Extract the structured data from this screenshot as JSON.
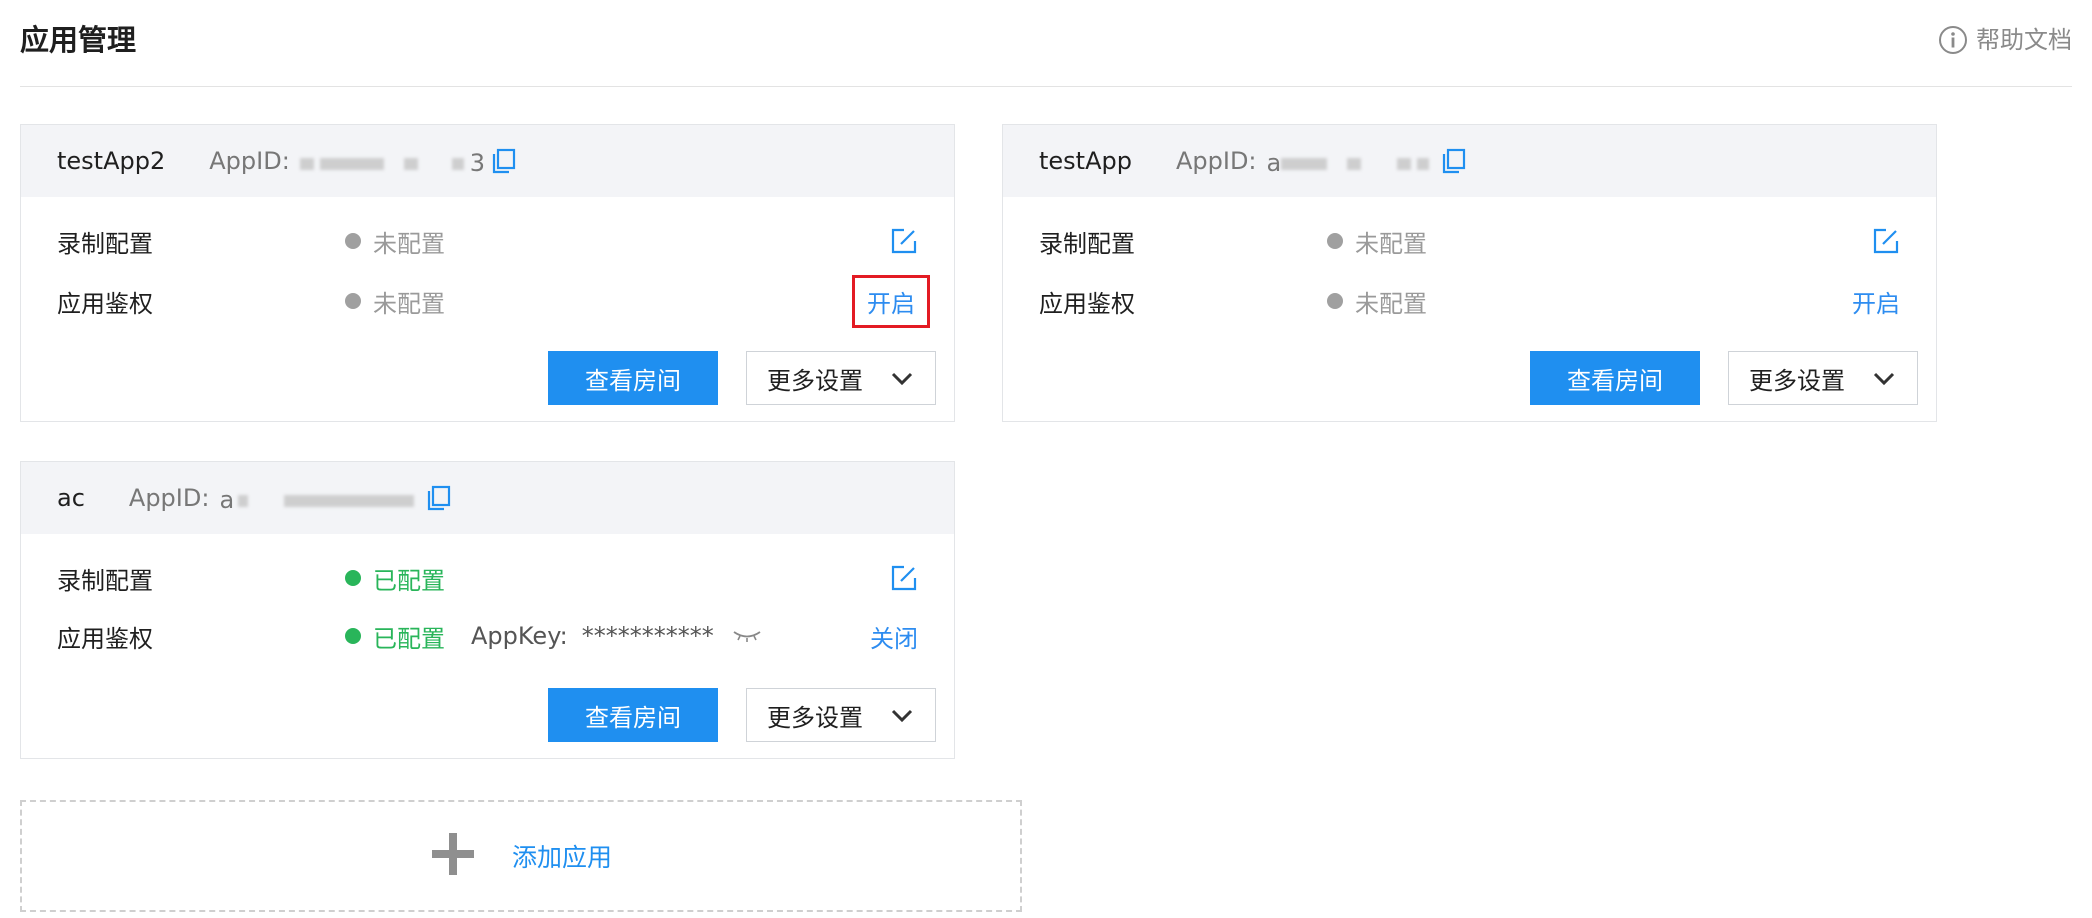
{
  "page": {
    "title": "应用管理",
    "help_label": "帮助文档"
  },
  "cards": [
    {
      "name": "testApp2",
      "appid_label": "AppID:",
      "appid_visible": "3",
      "rows": [
        {
          "label": "录制配置",
          "status": "未配置"
        },
        {
          "label": "应用鉴权",
          "status": "未配置",
          "action": "开启"
        }
      ],
      "primary_button": "查看房间",
      "more_button": "更多设置"
    },
    {
      "name": "testApp",
      "appid_label": "AppID:",
      "appid_visible": "a",
      "rows": [
        {
          "label": "录制配置",
          "status": "未配置"
        },
        {
          "label": "应用鉴权",
          "status": "未配置",
          "action": "开启"
        }
      ],
      "primary_button": "查看房间",
      "more_button": "更多设置"
    },
    {
      "name": "ac",
      "appid_label": "AppID:",
      "appid_visible": "a",
      "rows": [
        {
          "label": "录制配置",
          "status": "已配置"
        },
        {
          "label": "应用鉴权",
          "status": "已配置",
          "appkey_label": "AppKey:",
          "appkey_value": "***********",
          "action": "关闭"
        }
      ],
      "primary_button": "查看房间",
      "more_button": "更多设置"
    }
  ],
  "add_app": {
    "label": "添加应用"
  },
  "colors": {
    "accent": "#1f8ff0",
    "link": "#2d8cf0",
    "success": "#29b55a",
    "muted": "#a0a0a0",
    "highlight_border": "#e31b23"
  }
}
